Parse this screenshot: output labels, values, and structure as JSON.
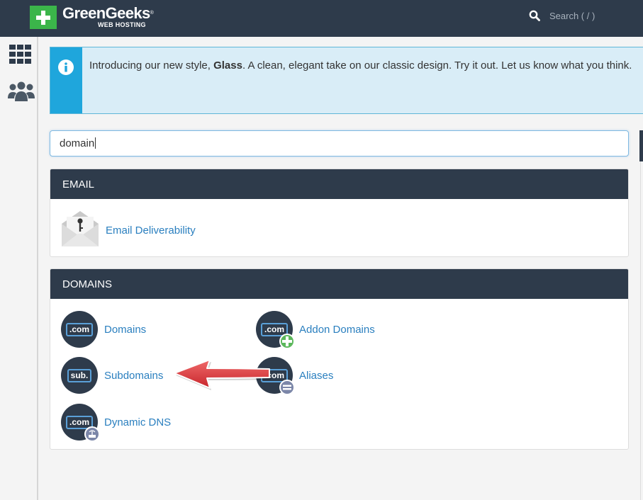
{
  "header": {
    "brand_name": "GreenGeeks",
    "brand_sub": "WEB HOSTING",
    "search_label": "Search ( / )"
  },
  "sidebar": {
    "items": [
      {
        "icon": "grid-icon"
      },
      {
        "icon": "users-icon"
      }
    ]
  },
  "notice": {
    "text_before": "Introducing our new style, ",
    "text_bold": "Glass",
    "text_after": ". A clean, elegant take on our classic design. Try it out. Let us know what you think."
  },
  "search": {
    "value": "domain"
  },
  "sections": {
    "email": {
      "title": "EMAIL",
      "items": [
        {
          "label": "Email Deliverability",
          "icon": "envelope-key-icon"
        }
      ]
    },
    "domains": {
      "title": "DOMAINS",
      "items": [
        {
          "label": "Domains",
          "tag": ".com",
          "icon": "domains-icon"
        },
        {
          "label": "Addon Domains",
          "tag": ".com",
          "icon": "addon-domains-icon"
        },
        {
          "label": "Subdomains",
          "tag": "sub.",
          "icon": "subdomains-icon"
        },
        {
          "label": "Aliases",
          "tag": ".com",
          "icon": "aliases-icon"
        },
        {
          "label": "Dynamic DNS",
          "tag": ".com",
          "icon": "dynamic-dns-icon"
        }
      ]
    }
  },
  "colors": {
    "topbar": "#2e3b4b",
    "brand_green": "#3bb54a",
    "link": "#2a7fbf",
    "info": "#1fa6dc",
    "arrow": "#d9363e"
  }
}
